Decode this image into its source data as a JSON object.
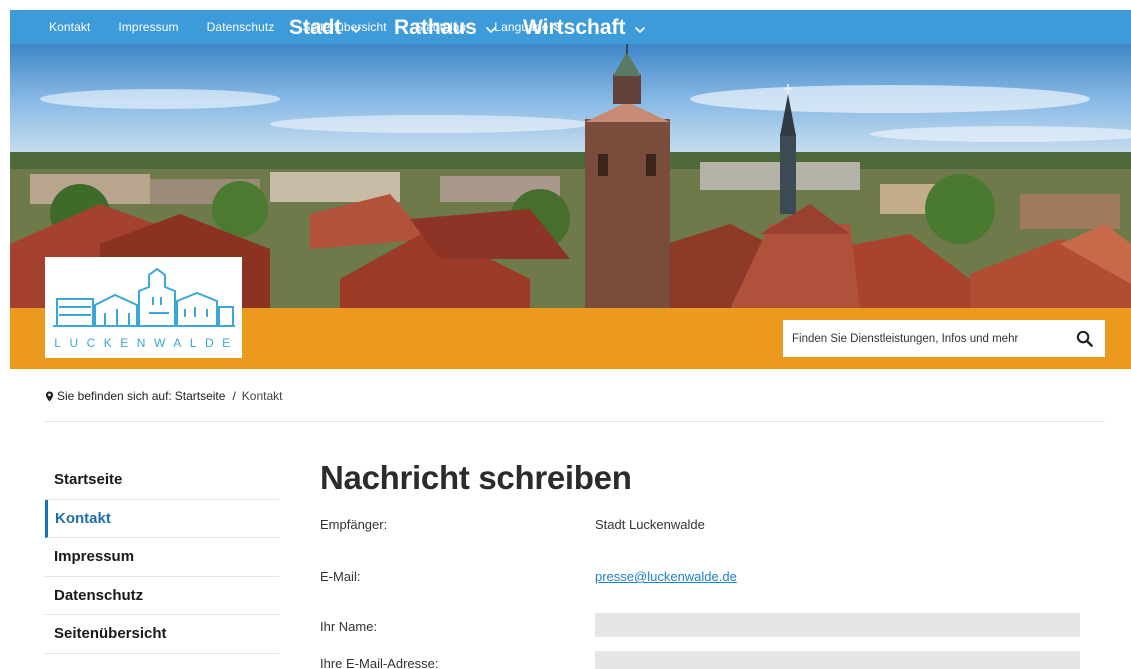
{
  "topnav": {
    "items": [
      "Kontakt",
      "Impressum",
      "Datenschutz",
      "Seitenübersicht",
      "Stadtplan"
    ],
    "language": "Language"
  },
  "logo": {
    "wordmark": "LUCKENWALDE"
  },
  "mainnav": {
    "items": [
      "Stadt",
      "Rathaus",
      "Wirtschaft"
    ]
  },
  "search": {
    "placeholder": "Finden Sie Dienstleistungen, Infos und mehr"
  },
  "breadcrumb": {
    "prefix": "Sie befinden sich auf:",
    "home": "Startseite",
    "separator": "/",
    "current": "Kontakt"
  },
  "sidebar": {
    "items": [
      {
        "label": "Startseite"
      },
      {
        "label": "Kontakt",
        "active": true
      },
      {
        "label": "Impressum"
      },
      {
        "label": "Datenschutz"
      },
      {
        "label": "Seitenübersicht"
      }
    ]
  },
  "form": {
    "title": "Nachricht schreiben",
    "recipient_label": "Empfänger:",
    "recipient_value": "Stadt Luckenwalde",
    "email_label": "E-Mail:",
    "email_value": "presse@luckenwalde.de",
    "name_label": "Ihr Name:",
    "name_value": "",
    "user_email_label": "Ihre E-Mail-Adresse:",
    "user_email_value": ""
  },
  "colors": {
    "topbar": "#3d9bd9",
    "navband": "#eb9a1f",
    "link": "#1e80c9",
    "active": "#1e6fb0"
  }
}
